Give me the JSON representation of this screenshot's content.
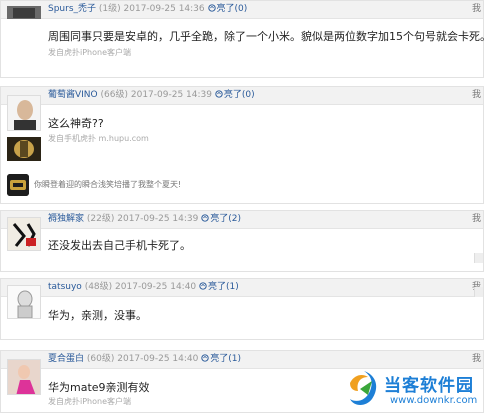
{
  "posts": [
    {
      "username": "Spurs_禿子",
      "level": "(1级)",
      "date": "2017-09-25 14:36",
      "light_label": "亮了(0)",
      "reply": "我",
      "text": "周围同事只要是安卓的，几乎全跪，除了一个小米。貌似是两位数字加15个句号就会卡死。",
      "client": "发自虎扑iPhone客户端"
    },
    {
      "username": "葡萄酱VINO",
      "level": "(66级)",
      "date": "2017-09-25 14:39",
      "light_label": "亮了(0)",
      "reply": "我",
      "text": "这么神奇??",
      "client": "发自手机虎扑 m.hupu.com",
      "signature": "你瞬登着迎的瞬合浅笑培播了我整个夏天!"
    },
    {
      "username": "褥独解家",
      "level": "(22级)",
      "date": "2017-09-25 14:39",
      "light_label": "亮了(2)",
      "reply": "我",
      "text": "还没发出去自己手机卡死了。"
    },
    {
      "username": "tatsuyo",
      "level": "(48级)",
      "date": "2017-09-25 14:40",
      "light_label": "亮了(1)",
      "reply": "我",
      "text": "华为，亲测，没事。"
    },
    {
      "username": "夏合蛋白",
      "level": "(60级)",
      "date": "2017-09-25 14:40",
      "light_label": "亮了(1)",
      "reply": "我",
      "text": "华为mate9亲测有效",
      "client": "发自虎扑iPhone客户端"
    }
  ],
  "watermark": {
    "title": "当客软件园",
    "url": "www.downkr.com"
  },
  "colors": {
    "username": "#2a5a9a",
    "header_bg": "#f2f2f2",
    "watermark": "#1d7fd6"
  }
}
